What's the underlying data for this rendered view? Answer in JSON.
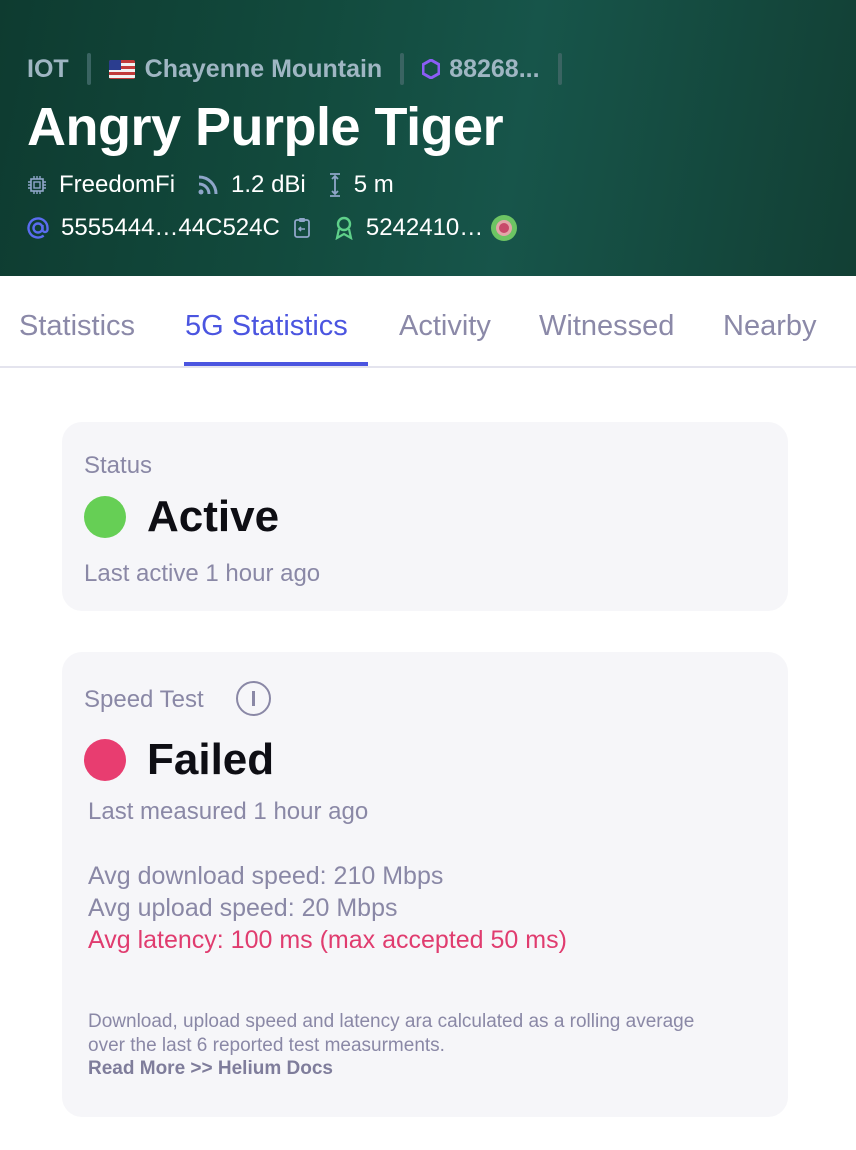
{
  "header": {
    "crumbs": {
      "network": "IOT",
      "location": "Chayenne Mountain",
      "hex": "88268..."
    },
    "title": "Angry Purple Tiger",
    "maker": "FreedomFi",
    "antenna_gain": "1.2 dBi",
    "elevation": "5 m",
    "address": "5555444…44C524C",
    "owner": "5242410…",
    "colors": {
      "background": "#124a3d",
      "crumb": "#9fb6c3",
      "hex_icon": "#8b5cf6",
      "address_icon": "#5a6cf0",
      "owner_icon": "#5fd08a"
    }
  },
  "tabs": [
    {
      "label": "Statistics",
      "active": false
    },
    {
      "label": "5G Statistics",
      "active": true
    },
    {
      "label": "Activity",
      "active": false
    },
    {
      "label": "Witnessed",
      "active": false
    },
    {
      "label": "Nearby",
      "active": false
    }
  ],
  "status_card": {
    "label": "Status",
    "value": "Active",
    "dot_color": "#66cf55",
    "last": "Last active 1 hour ago"
  },
  "speed_card": {
    "label": "Speed Test",
    "value": "Failed",
    "dot_color": "#e83d70",
    "last": "Last measured 1 hour ago",
    "download": "Avg download speed: 210 Mbps",
    "upload": "Avg upload speed: 20 Mbps",
    "latency": "Avg latency: 100 ms (max accepted 50 ms)",
    "note": "Download, upload speed and latency ara calculated as a rolling average over the last 6 reported test measurments.",
    "read_more": "Read More >> Helium Docs"
  }
}
